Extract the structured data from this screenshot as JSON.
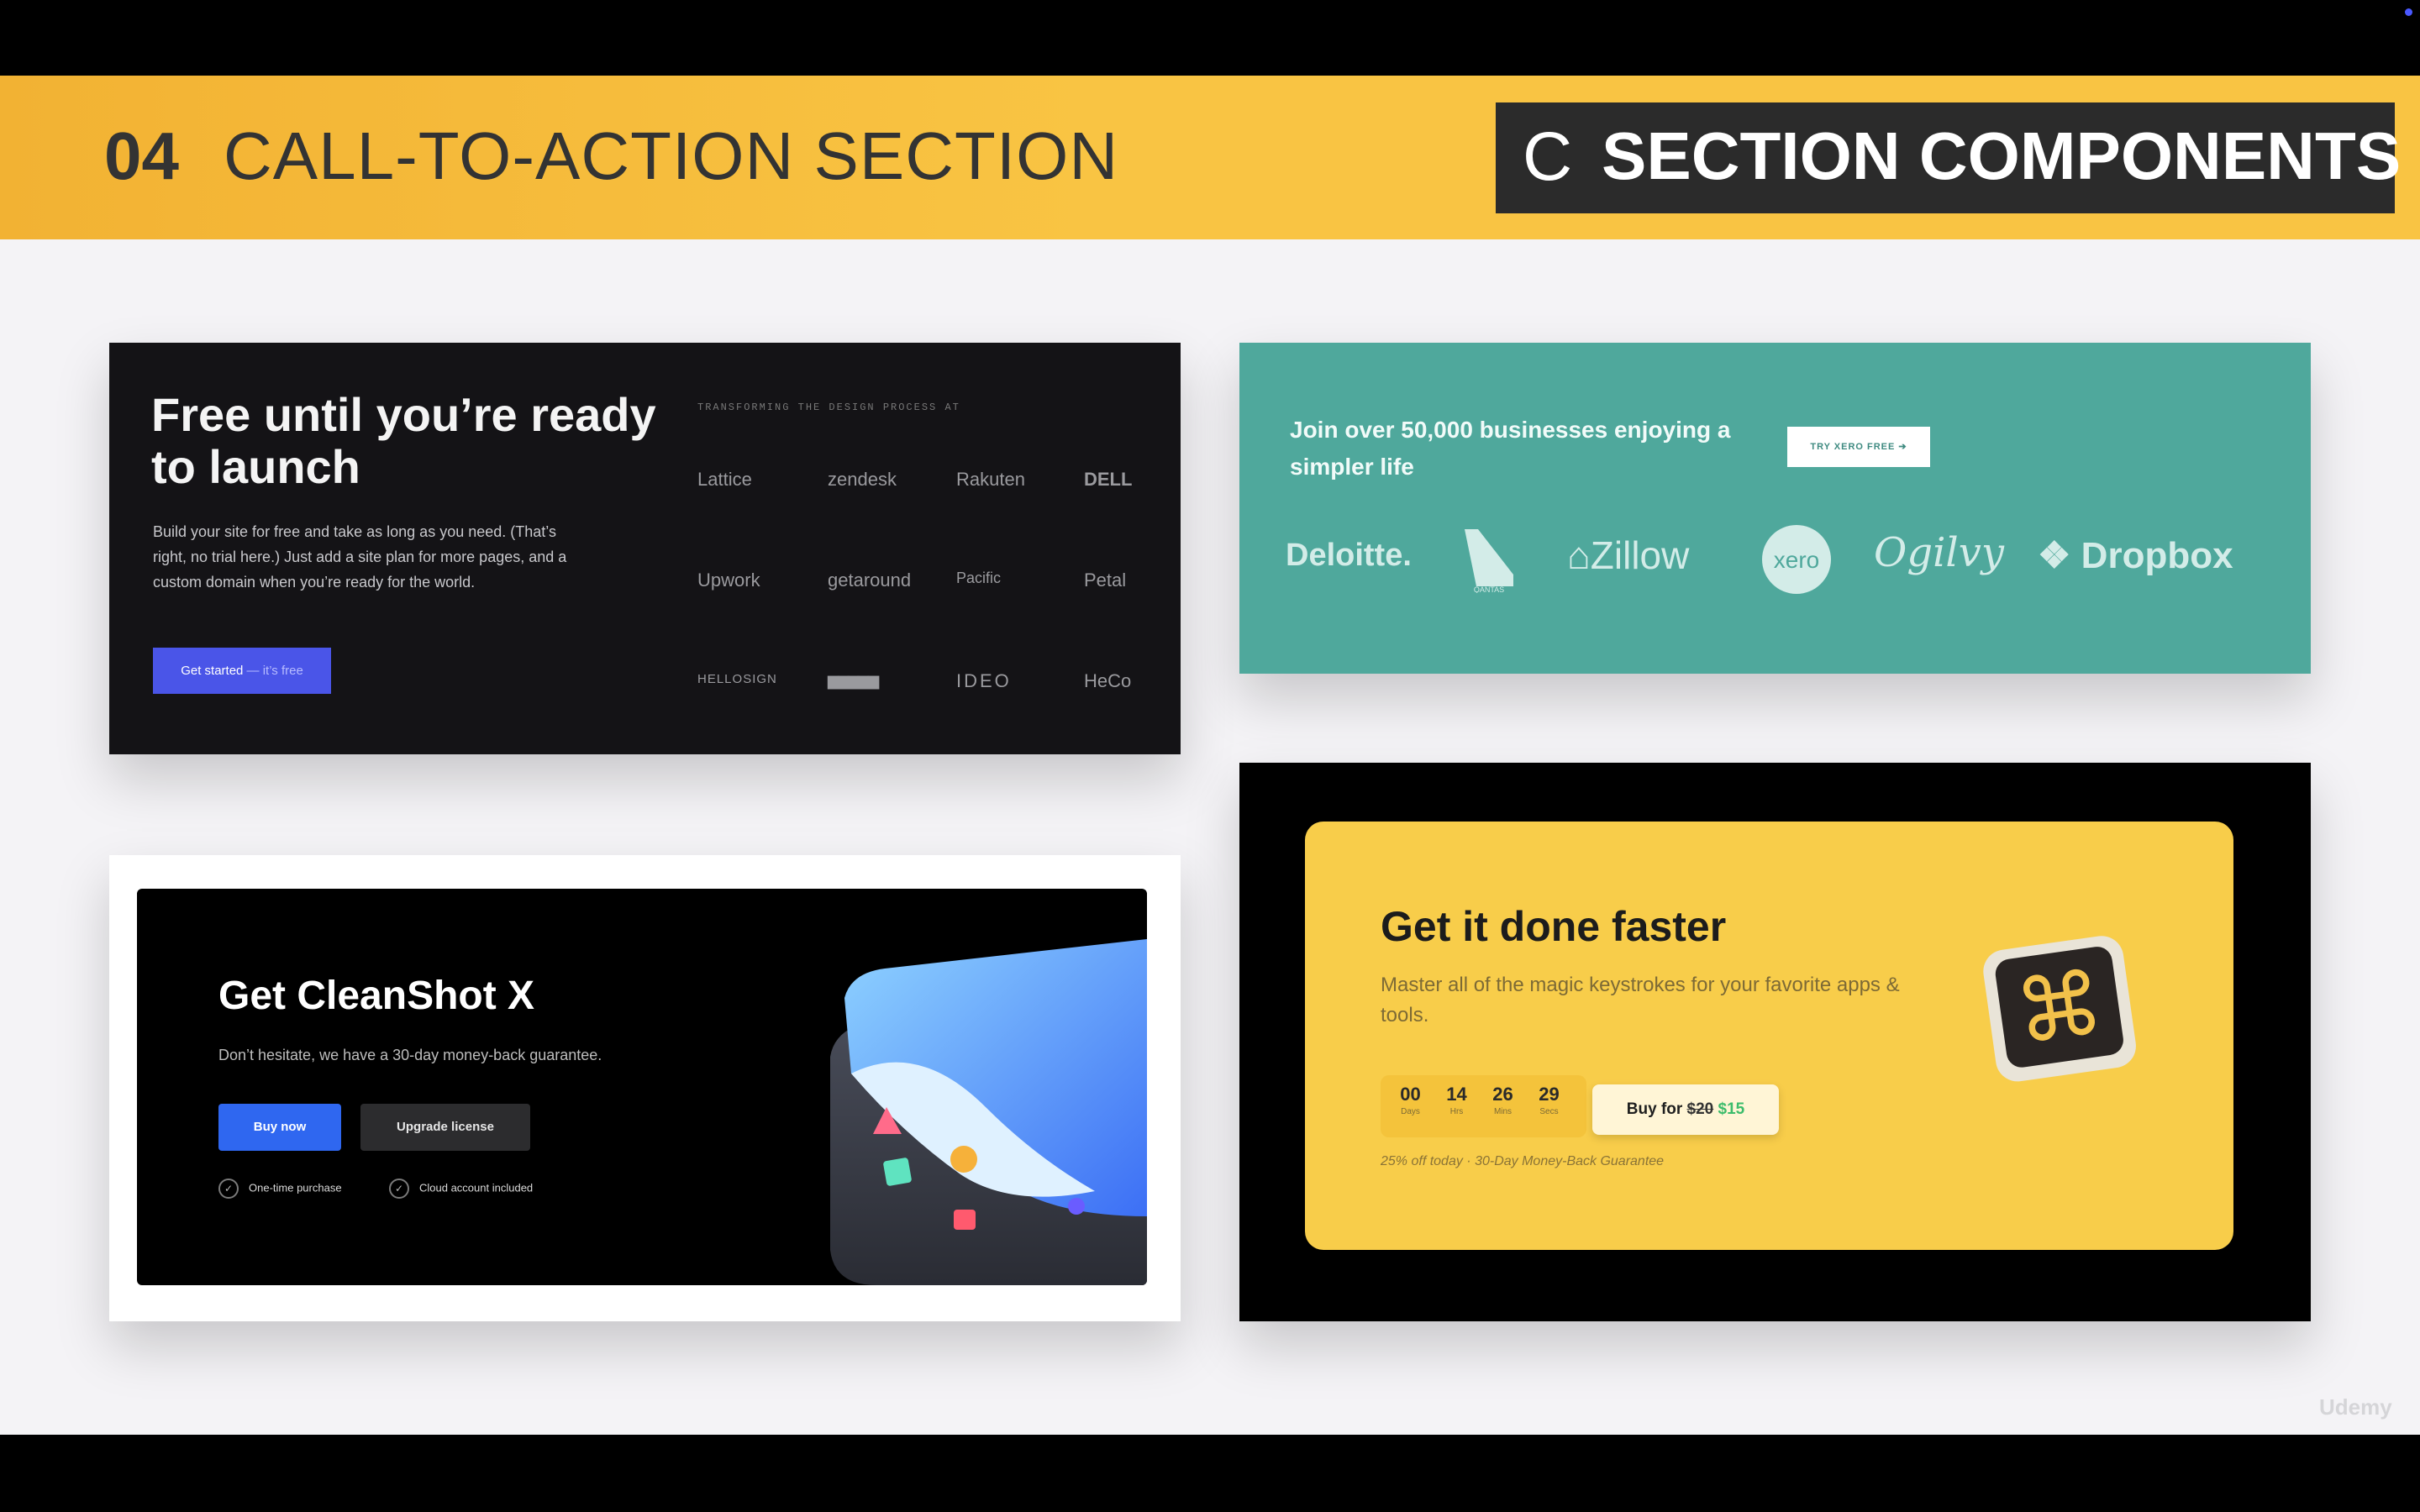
{
  "header": {
    "number": "04",
    "title": "CALL-TO-ACTION SECTION",
    "badge_letter": "C",
    "badge_title": "SECTION COMPONENTS"
  },
  "card1": {
    "title": "Free until you’re ready to launch",
    "body": "Build your site for free and take as long as you need. (That’s right, no trial here.) Just add a site plan for more pages, and a custom domain when you’re ready for the world.",
    "button_main": "Get started",
    "button_dim": " — it’s free",
    "overline": "TRANSFORMING THE DESIGN PROCESS AT",
    "logos": [
      "Lattice",
      "zendesk",
      "Rakuten",
      "DELL",
      "Upwork",
      "getaround",
      "Pacific",
      "Petal",
      "HELLOSIGN",
      "▆▆▆▆▆",
      "IDEO",
      "HeCo"
    ]
  },
  "card2": {
    "text": "Join over 50,000 businesses enjoying a simpler life",
    "button": "TRY XERO FREE ➔",
    "logos": [
      "Deloitte.",
      "QANTAS",
      "Zillow",
      "xero",
      "Ogilvy",
      "Dropbox"
    ]
  },
  "card3": {
    "title": "Get CleanShot X",
    "subtitle": "Don’t hesitate, we have a 30-day money-back guarantee.",
    "buy_button": "Buy now",
    "upgrade_button": "Upgrade license",
    "checks": [
      "One-time purchase",
      "Cloud account included"
    ]
  },
  "card4": {
    "title": "Get it done faster",
    "subtitle": "Master all of the magic keystrokes for your favorite apps & tools.",
    "timer": [
      {
        "value": "00",
        "label": "Days"
      },
      {
        "value": "14",
        "label": "Hrs"
      },
      {
        "value": "26",
        "label": "Mins"
      },
      {
        "value": "29",
        "label": "Secs"
      }
    ],
    "buy_prefix": "Buy for ",
    "old_price": "$20",
    "new_price": "$15",
    "note": "25% off today · 30-Day Money-Back Guarantee"
  },
  "watermark": "Udemy",
  "colors": {
    "header": "#f9c443",
    "teal": "#4fa89c",
    "yellow": "#f8cd4a",
    "blue": "#2f67f0",
    "indigo": "#4a55e8"
  }
}
